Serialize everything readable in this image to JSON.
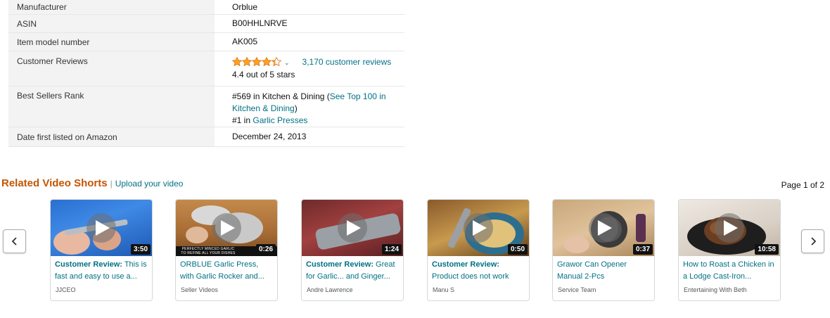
{
  "details": [
    {
      "label": "Manufacturer",
      "value": "Orblue"
    },
    {
      "label": "ASIN",
      "value": "B00HHLNRVE"
    },
    {
      "label": "Item model number",
      "value": "AK005"
    },
    {
      "label": "Customer Reviews",
      "rating_value": 4.4,
      "rating_text": "4.4 out of 5 stars",
      "reviews_link": "3,170 customer reviews"
    },
    {
      "label": "Best Sellers Rank",
      "rank1_prefix": "#569 in Kitchen & Dining (",
      "rank1_link": "See Top 100 in Kitchen & Dining",
      "rank1_suffix": ")",
      "rank2_prefix": "#1 in ",
      "rank2_link": "Garlic Presses"
    },
    {
      "label": "Date first listed on Amazon",
      "value": "December 24, 2013"
    }
  ],
  "related": {
    "title": "Related Video Shorts",
    "separator": "|",
    "upload_link": "Upload your video",
    "page_indicator": "Page 1 of 2"
  },
  "videos": [
    {
      "prefix": "Customer Review:",
      "title": " This is fast and easy to use a...",
      "author": "JJCEO",
      "duration": "3:50"
    },
    {
      "prefix": "",
      "title": "ORBLUE Garlic Press, with Garlic Rocker and...",
      "author": "Seller Videos",
      "duration": "0:26",
      "caption": "PERFECTLY MINCED GARLIC TO REFINE ALL YOUR DISHES"
    },
    {
      "prefix": "Customer Review:",
      "title": " Great for Garlic... and Ginger...",
      "author": "Andre Lawrence",
      "duration": "1:24"
    },
    {
      "prefix": "Customer Review:",
      "title": " Product does not work",
      "author": "Manu S",
      "duration": "0:50"
    },
    {
      "prefix": "",
      "title": "Grawor Can Opener Manual 2-Pcs",
      "author": "Service Team",
      "duration": "0:37"
    },
    {
      "prefix": "",
      "title": "How to Roast a Chicken in a Lodge Cast-Iron...",
      "author": "Entertaining With Beth",
      "duration": "10:58"
    }
  ],
  "icons": {
    "star_color": "#ffa41c",
    "star_stroke": "#de7921",
    "prev": "chevron-left-icon",
    "next": "chevron-right-icon",
    "play": "play-icon"
  }
}
